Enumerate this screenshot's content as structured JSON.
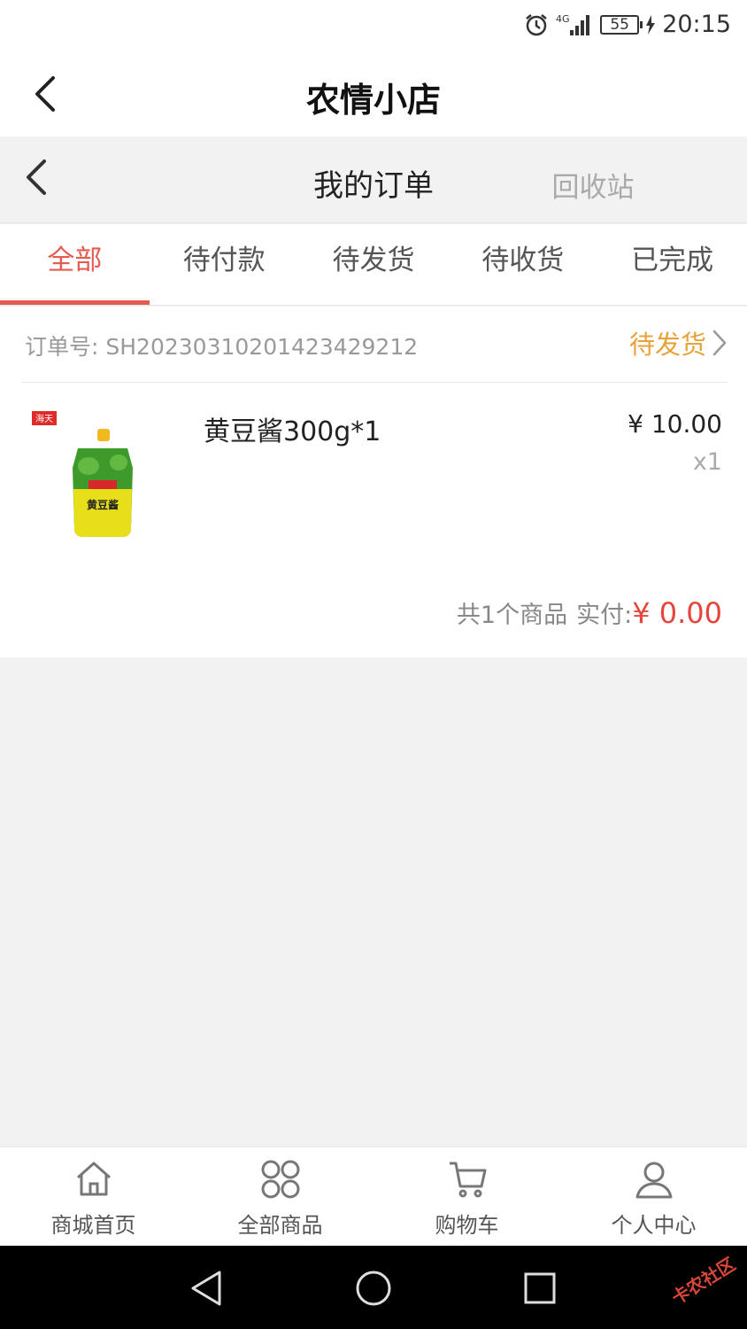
{
  "status_bar": {
    "time": "20:15",
    "battery": "55",
    "network": "4G"
  },
  "app_header": {
    "title": "农情小店"
  },
  "sub_header": {
    "title": "我的订单",
    "recycle": "回收站"
  },
  "tabs": [
    {
      "label": "全部",
      "active": true
    },
    {
      "label": "待付款",
      "active": false
    },
    {
      "label": "待发货",
      "active": false
    },
    {
      "label": "待收货",
      "active": false
    },
    {
      "label": "已完成",
      "active": false
    }
  ],
  "order": {
    "number": "订单号: SH20230310201423429212",
    "status": "待发货",
    "product": {
      "name": "黄豆酱300g*1",
      "price": "¥ 10.00",
      "qty": "x1",
      "brand_label": "海天",
      "package_text": "黄豆酱"
    },
    "summary": {
      "count": "共1个商品",
      "paid_label": "实付:",
      "amount": "¥ 0.00"
    }
  },
  "bottom_nav": [
    {
      "label": "商城首页",
      "icon": "home-icon"
    },
    {
      "label": "全部商品",
      "icon": "grid-icon"
    },
    {
      "label": "购物车",
      "icon": "cart-icon"
    },
    {
      "label": "个人中心",
      "icon": "user-icon"
    }
  ],
  "watermark": "卡农社区",
  "colors": {
    "accent": "#e65b50",
    "status_orange": "#e8a23a",
    "price_red": "#e6453c"
  }
}
